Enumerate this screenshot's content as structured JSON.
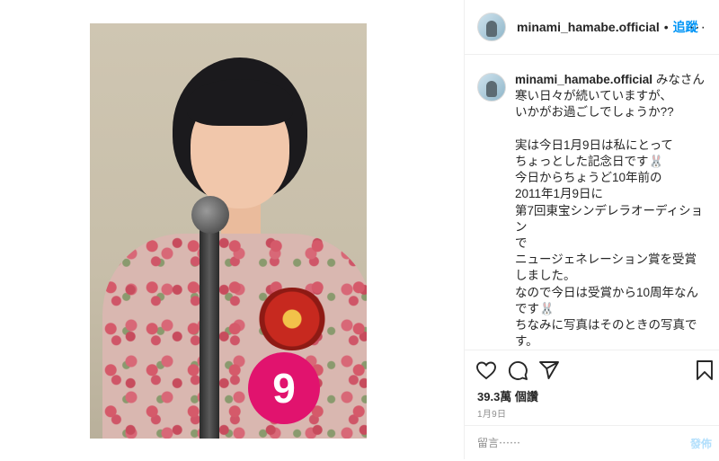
{
  "post": {
    "username": "minami_hamabe.official",
    "follow_label": "追蹤",
    "separator": "•",
    "more_label": "···",
    "caption": "みなさん寒い日々が続いていますが、\nいかがお過ごしでしょうか??\n\n実は今日1月9日は私にとって\nちょっとした記念日です🐰\n今日からちょうど10年前の\n2011年1月9日に\n第7回東宝シンデレラオーディション\nで\nニュージェネレーション賞を受賞しました。\nなので今日は受賞から10周年なんです🐰\nちなみに写真はそのときの写真です。\n\nそのオーディションの最後のスピーチで\n私は\n『明るくて優しい女優さんになりた",
    "likes": "39.3萬 個讚",
    "date": "1月9日",
    "comment_placeholder": "留言⋯⋯",
    "post_button": "發佈",
    "photo_badge_number": "9"
  },
  "icons": {
    "like": "heart-icon",
    "comment": "comment-icon",
    "share": "paper-plane-icon",
    "save": "bookmark-icon"
  },
  "colors": {
    "accent": "#0095f6",
    "badge": "#e1136e",
    "post_button_disabled": "#b2dffc"
  }
}
